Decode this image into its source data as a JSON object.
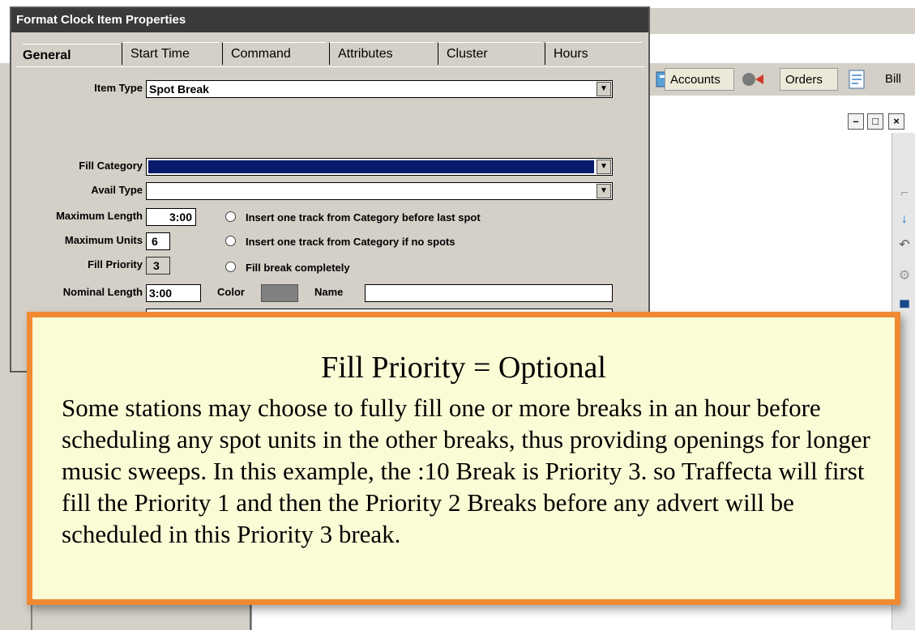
{
  "dialog": {
    "title": "Format Clock Item Properties",
    "tabs": [
      "General",
      "Start Time",
      "Command",
      "Attributes",
      "Cluster",
      "Hours"
    ],
    "active_tab": "General",
    "item_type": {
      "label": "Item Type",
      "value": "Spot Break"
    },
    "fill_category": {
      "label": "Fill Category",
      "value": "",
      "color": "#0a1a6b"
    },
    "avail_type": {
      "label": "Avail Type",
      "value": ""
    },
    "maximum_length": {
      "label": "Maximum Length",
      "value": "3:00"
    },
    "maximum_units": {
      "label": "Maximum Units",
      "value": "6"
    },
    "fill_priority": {
      "label": "Fill Priority",
      "value": "3",
      "highlight": "#ffff44"
    },
    "nominal_length": {
      "label": "Nominal Length",
      "value": "3:00"
    },
    "color": {
      "label": "Color",
      "value": "#808080"
    },
    "name": {
      "label": "Name",
      "value": ""
    },
    "radio_options": [
      "Insert one track from Category before last spot",
      "Insert one track from Category if no spots",
      "Fill break completely"
    ]
  },
  "toolbar": {
    "accounts": "Accounts",
    "orders": "Orders",
    "bill": "Bill"
  },
  "window_controls": {
    "minimize": "–",
    "restore": "□",
    "close": "×"
  },
  "callout": {
    "title": "Fill Priority = Optional",
    "body": "Some stations may choose to fully fill one or more breaks in an hour before scheduling any spot units in the other breaks, thus providing openings for longer music sweeps. In this example, the :10 Break is Priority 3. so Traffecta will first fill the Priority 1 and then the Priority 2 Breaks before any advert will be scheduled in this Priority 3 break.",
    "border_color": "#f08a32",
    "background": "#fbfbd6"
  }
}
